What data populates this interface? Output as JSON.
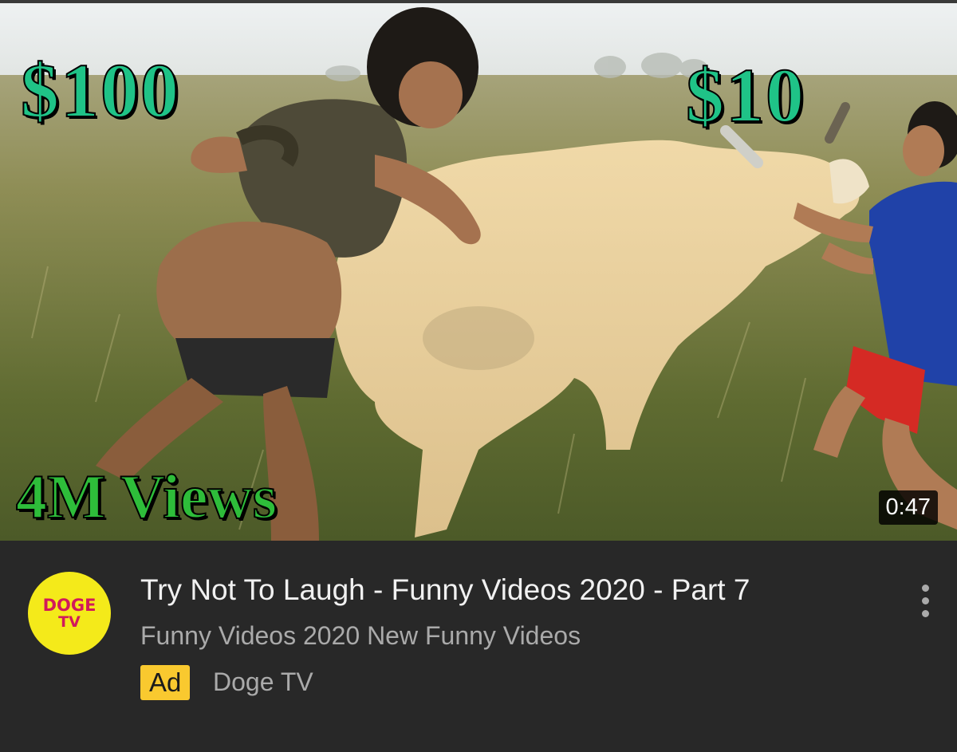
{
  "thumbnail": {
    "overlay_left_price": "$100",
    "overlay_right_price": "$10",
    "overlay_views": "4M Views",
    "duration": "0:47"
  },
  "video": {
    "title": "Try Not To Laugh - Funny Videos 2020 - Part 7",
    "description": "Funny Videos 2020 New Funny Videos",
    "ad_badge": "Ad",
    "advertiser": "Doge TV"
  },
  "channel_avatar": {
    "line1": "DOGE",
    "line2": "TV"
  },
  "icons": {
    "menu": "more-vert-icon"
  },
  "colors": {
    "background": "#282828",
    "overlay_price_text": "#1fc387",
    "overlay_views_text": "#2ebd3a",
    "ad_badge": "#f9c92f",
    "avatar_background": "#f4ea1a",
    "avatar_text": "#d11a5b"
  }
}
